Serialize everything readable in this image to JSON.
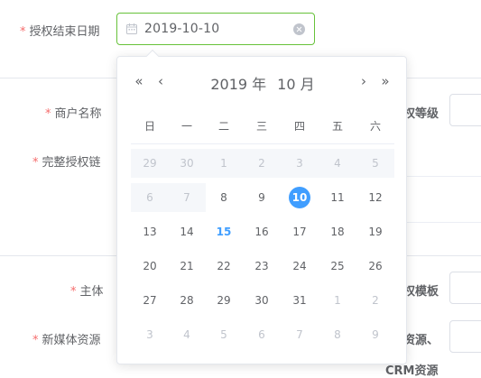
{
  "form": {
    "end_date_label": "授权结束日期",
    "merchant_label": "商户名称",
    "chain_label": "完整授权链",
    "subject_label": "主体",
    "media_label": "新媒体资源",
    "level_label_partial": "权等级",
    "template_label_partial": "权模板",
    "resource_label_partial": "资源、",
    "crm_label_partial": "CRM资源",
    "required_mark": "*"
  },
  "date_input": {
    "value": "2019-10-10",
    "icons": {
      "left": "calendar-icon",
      "right": "clear-circle-icon"
    }
  },
  "picker": {
    "year_text": "2019 年",
    "month_text": "10 月",
    "nav": {
      "prev_year": "«",
      "prev_month": "‹",
      "next_month": "›",
      "next_year": "»"
    },
    "weekdays": [
      "日",
      "一",
      "二",
      "三",
      "四",
      "五",
      "六"
    ],
    "weeks": [
      [
        "29",
        "30",
        "1",
        "2",
        "3",
        "4",
        "5"
      ],
      [
        "6",
        "7",
        "8",
        "9",
        "10",
        "11",
        "12"
      ],
      [
        "13",
        "14",
        "15",
        "16",
        "17",
        "18",
        "19"
      ],
      [
        "20",
        "21",
        "22",
        "23",
        "24",
        "25",
        "26"
      ],
      [
        "27",
        "28",
        "29",
        "30",
        "31",
        "1",
        "2"
      ],
      [
        "3",
        "4",
        "5",
        "6",
        "7",
        "8",
        "9"
      ]
    ],
    "selected_day": "10",
    "today_day": "15"
  },
  "colors": {
    "primary": "#409eff",
    "required": "#f56c6c",
    "focus_border": "#67c23a",
    "disabled_bg": "#f5f7fa",
    "muted_text": "#c0c4cc"
  }
}
